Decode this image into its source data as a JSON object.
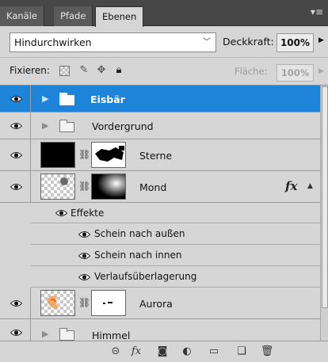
{
  "tabs": [
    {
      "label": "Kanäle",
      "active": false
    },
    {
      "label": "Pfade",
      "active": false
    },
    {
      "label": "Ebenen",
      "active": true
    }
  ],
  "panel_menu_icon": "panel-menu-icon",
  "blend": {
    "mode": "Hindurchwirken",
    "opacity_label": "Deckkraft:",
    "opacity_value": "100%"
  },
  "lock": {
    "label": "Fixieren:",
    "icons": [
      "lock-transparency-icon",
      "lock-pixels-icon",
      "lock-position-icon",
      "lock-all-icon"
    ],
    "fill_label": "Fläche:",
    "fill_value": "100%"
  },
  "layers": [
    {
      "name": "Eisbär",
      "type": "group",
      "selected": true,
      "visible": true
    },
    {
      "name": "Vordergrund",
      "type": "group",
      "selected": false,
      "visible": true
    },
    {
      "name": "Sterne",
      "type": "layer-mask",
      "selected": false,
      "visible": true
    },
    {
      "name": "Mond",
      "type": "layer-mask",
      "selected": false,
      "visible": true,
      "has_effects": true,
      "fx_label": "fx"
    },
    {
      "name": "Aurora",
      "type": "layer-mask",
      "selected": false,
      "visible": true
    },
    {
      "name": "Himmel",
      "type": "group",
      "selected": false,
      "visible": true
    }
  ],
  "effects": {
    "header": "Effekte",
    "items": [
      "Schein nach außen",
      "Schein nach innen",
      "Verlaufsüberlagerung"
    ]
  },
  "colors": {
    "selection": "#1e84d9",
    "panel_bg": "#d6d6d6",
    "tabbar_bg": "#474747"
  },
  "toolbar_icons": [
    "link-layers-icon",
    "add-style-icon",
    "add-mask-icon",
    "adjustment-layer-icon",
    "new-group-icon",
    "new-layer-icon",
    "trash-icon"
  ]
}
